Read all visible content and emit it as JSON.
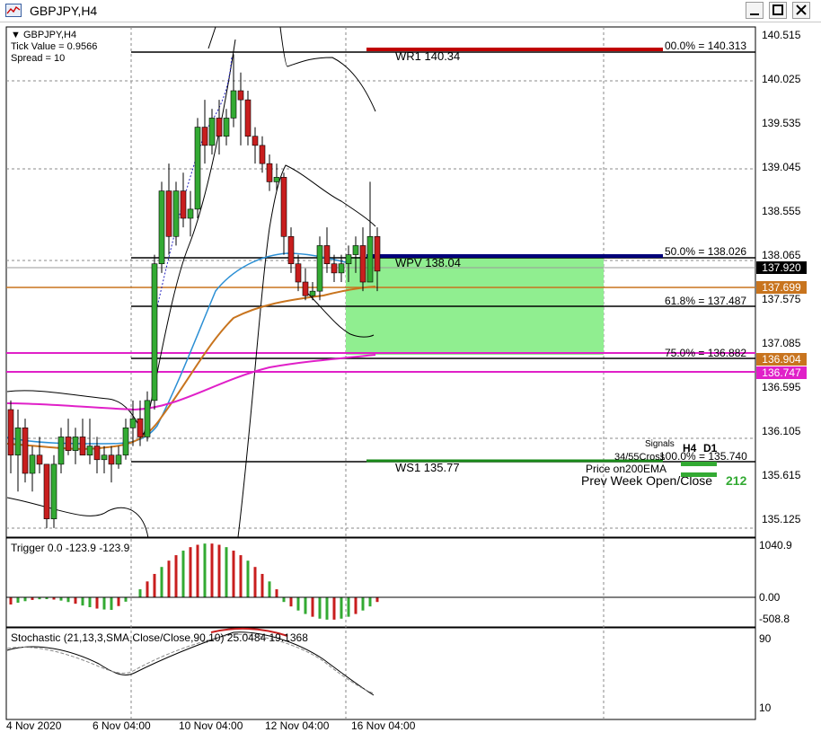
{
  "window": {
    "title": "GBPJPY,H4"
  },
  "header": {
    "symbol": "GBPJPY,H4",
    "tick_value": "Tick Value = 0.9566",
    "spread": "Spread = 10"
  },
  "price_axis": {
    "labels": [
      "140.515",
      "140.025",
      "139.535",
      "139.045",
      "138.555",
      "138.065",
      "137.575",
      "137.085",
      "136.595",
      "136.105",
      "135.615",
      "135.125"
    ],
    "current": "137.920",
    "ema_tag": "137.699",
    "tag_1": "136.904",
    "tag_2": "136.747"
  },
  "fibo": {
    "f0": "00.0% = 140.313",
    "f50": "50.0% = 138.026",
    "f618": "61.8% = 137.487",
    "f75": "75.0% = 136.882",
    "f100": "100.0% = 135.740"
  },
  "pivots": {
    "wr1": "WR1   140.34",
    "wpv": "WPV   138.04",
    "ws1": "WS1   135.77"
  },
  "signals": {
    "title": "Signals",
    "h4": "H4",
    "d1": "D1",
    "row1": "34/55Cross",
    "row2": "Price on200EMA",
    "row3": "Prev Week Open/Close",
    "row3_value": "212"
  },
  "trigger": {
    "label": "Trigger 0.0 -123.9 -123.9",
    "top": "1040.9",
    "zero": "0.00",
    "bottom": "-508.8"
  },
  "stochastic": {
    "label": "Stochastic (21,13,3,SMA,Close/Close,90,10) 25.0484 19.1368",
    "top": "90",
    "bottom": "10"
  },
  "time_axis": [
    "4 Nov 2020",
    "6 Nov 04:00",
    "10 Nov 04:00",
    "12 Nov 04:00",
    "16 Nov 04:00"
  ],
  "colors": {
    "up": "#33aa33",
    "down": "#c81e1e",
    "ema_fast": "#2b8fd4",
    "ema_slow": "#c8741e",
    "ema200": "#e020c8",
    "wpv_line": "#00007a",
    "pivot_red": "#c00000",
    "zone": "#90ee90"
  },
  "chart_data": {
    "type": "candlestick",
    "ylim": [
      135.0,
      140.6
    ],
    "candles": [
      [
        136.4,
        136.5,
        135.7,
        135.9
      ],
      [
        135.9,
        136.4,
        135.5,
        136.2
      ],
      [
        136.2,
        136.3,
        135.6,
        135.7
      ],
      [
        135.7,
        136.0,
        135.5,
        135.9
      ],
      [
        135.9,
        136.1,
        135.7,
        135.8
      ],
      [
        135.8,
        135.8,
        135.1,
        135.2
      ],
      [
        135.2,
        135.9,
        135.1,
        135.8
      ],
      [
        135.8,
        136.2,
        135.7,
        136.1
      ],
      [
        136.1,
        136.3,
        135.9,
        135.95
      ],
      [
        135.95,
        136.2,
        135.8,
        136.1
      ],
      [
        136.1,
        136.3,
        135.9,
        135.9
      ],
      [
        135.9,
        136.3,
        135.8,
        136.0
      ],
      [
        136.0,
        136.1,
        135.7,
        135.85
      ],
      [
        135.85,
        136.0,
        135.7,
        135.9
      ],
      [
        135.9,
        136.0,
        135.6,
        135.8
      ],
      [
        135.8,
        136.0,
        135.75,
        135.9
      ],
      [
        135.9,
        136.3,
        135.85,
        136.2
      ],
      [
        136.2,
        136.5,
        136.0,
        136.3
      ],
      [
        136.3,
        136.5,
        136.0,
        136.1
      ],
      [
        136.1,
        136.6,
        136.05,
        136.5
      ],
      [
        136.5,
        138.1,
        136.4,
        138.0
      ],
      [
        138.0,
        138.9,
        137.9,
        138.8
      ],
      [
        138.8,
        139.1,
        138.1,
        138.3
      ],
      [
        138.3,
        138.9,
        138.2,
        138.8
      ],
      [
        138.8,
        139.0,
        138.4,
        138.5
      ],
      [
        138.5,
        138.8,
        138.3,
        138.6
      ],
      [
        138.6,
        139.6,
        138.5,
        139.5
      ],
      [
        139.5,
        139.8,
        139.1,
        139.3
      ],
      [
        139.3,
        139.7,
        139.2,
        139.6
      ],
      [
        139.6,
        139.8,
        139.2,
        139.4
      ],
      [
        139.4,
        139.7,
        139.3,
        139.6
      ],
      [
        139.6,
        140.3,
        139.5,
        139.9
      ],
      [
        139.9,
        140.1,
        139.3,
        139.8
      ],
      [
        139.8,
        139.9,
        139.3,
        139.4
      ],
      [
        139.4,
        139.5,
        139.1,
        139.3
      ],
      [
        139.3,
        139.4,
        139.0,
        139.1
      ],
      [
        139.1,
        139.2,
        138.8,
        138.9
      ],
      [
        138.9,
        139.1,
        138.8,
        138.95
      ],
      [
        138.95,
        139.0,
        138.1,
        138.3
      ],
      [
        138.3,
        138.4,
        137.9,
        138.0
      ],
      [
        138.0,
        138.1,
        137.7,
        137.8
      ],
      [
        137.8,
        137.95,
        137.6,
        137.65
      ],
      [
        137.65,
        137.8,
        137.6,
        137.7
      ],
      [
        137.7,
        138.3,
        137.6,
        138.2
      ],
      [
        138.2,
        138.4,
        137.9,
        138.0
      ],
      [
        138.0,
        138.1,
        137.8,
        137.9
      ],
      [
        137.9,
        138.1,
        137.8,
        138.0
      ],
      [
        138.0,
        138.2,
        137.8,
        138.1
      ],
      [
        138.1,
        138.3,
        137.9,
        138.2
      ],
      [
        138.2,
        138.4,
        137.7,
        137.8
      ],
      [
        137.8,
        138.9,
        137.8,
        138.3
      ],
      [
        138.3,
        138.4,
        137.7,
        137.92
      ]
    ]
  }
}
